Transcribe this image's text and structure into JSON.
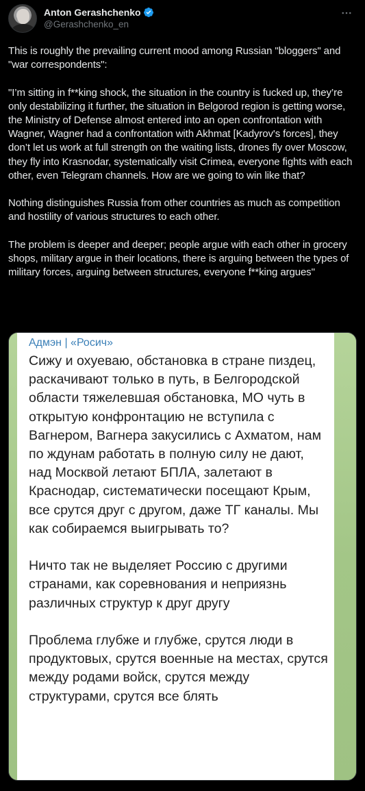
{
  "tweet": {
    "author": {
      "display_name": "Anton Gerashchenko",
      "handle": "@Gerashchenko_en",
      "verified": true,
      "verified_icon": "verified-badge-icon",
      "accent_color": "#1d9bf0"
    },
    "more_icon": "more-horizontal-icon",
    "text": "This is roughly the prevailing current mood among Russian \"bloggers\" and \"war correspondents\":\n\n\"I’m sitting in f**king shock, the situation in the country is fucked up, they’re only destabilizing it further, the situation in Belgorod region is getting worse, the Ministry of Defense almost entered into an open confrontation with Wagner, Wagner had a confrontation with Akhmat [Kadyrov's forces], they don’t let us work at full strength on the waiting lists, drones fly over Moscow,  they fly into Krasnodar, systematically visit Crimea, everyone fights with each other, even Telegram channels. How are we going to win like that?\n\nNothing distinguishes Russia from other countries as much as competition and hostility of various structures to each other.\n\nThe problem is deeper and deeper; people argue with each other in grocery shops, military argue in their locations, there is arguing between the types of military forces, arguing between structures, everyone f**king argues\""
  },
  "media": {
    "sender": "Адмэн | «Росич»",
    "message": "Сижу и охуеваю, обстановка в стране пиздец, раскачивают только в путь, в Белгородской области тяжелевшая обстановка, МО чуть в открытую конфронтацию не вступила с Вагнером, Вагнера закусились с Ахматом, нам по ждунам работать в полную силу не дают, над Москвой летают БПЛА, залетают в Краснодар, систематически посещают Крым, все срутся друг с другом, даже ТГ каналы. Мы как собираемся выигрывать то?\n\nНичто так не выделяет Россию с другими странами, как соревнования и неприязнь различных структур к друг другу\n\nПроблема глубже и глубже, срутся люди в продуктовых, срутся военные на местах, срутся между родами войск, срутся между структурами, срутся все блять"
  }
}
